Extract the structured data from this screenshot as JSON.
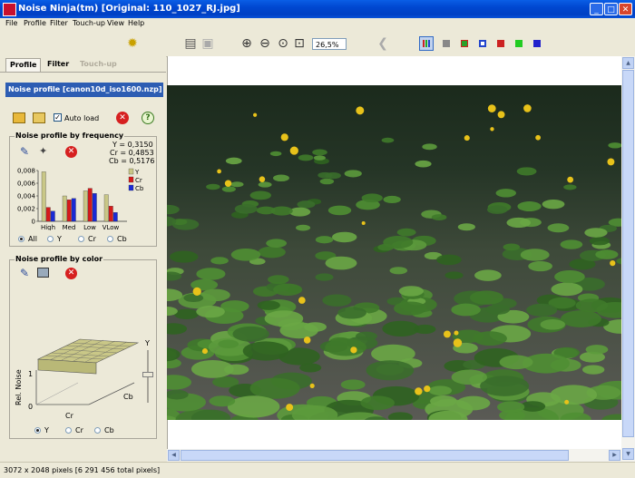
{
  "window": {
    "title": "Noise Ninja(tm)   [Original:  110_1027_RJ.jpg]"
  },
  "menu": [
    "File",
    "Profile",
    "Filter",
    "Touch-up",
    "View",
    "Help"
  ],
  "toolbar": {
    "zoom": "26,5%"
  },
  "colors": {
    "accent": "#2d5db3",
    "titlebar": "#0047d0",
    "swatches": [
      "#cc2222",
      "#888888",
      "#2aa02a",
      "#2244cc",
      "#cc2222",
      "#22cc22",
      "#2222cc"
    ]
  },
  "tabs": [
    "Profile",
    "Filter",
    "Touch-up"
  ],
  "profile": {
    "name": "Noise profile [canon10d_iso1600.nzp]",
    "autoload_label": "Auto load",
    "autoload_checked": true
  },
  "frequency": {
    "title": "Noise profile by frequency",
    "readout": {
      "y": "Y = 0,3150",
      "cr": "Cr = 0,4853",
      "cb": "Cb = 0,5176"
    },
    "radios": [
      "All",
      "Y",
      "Cr",
      "Cb"
    ],
    "selected_radio": "All"
  },
  "chart_data": {
    "type": "bar",
    "categories": [
      "High",
      "Med",
      "Low",
      "VLow"
    ],
    "series": [
      {
        "name": "Y",
        "values": [
          0.0078,
          0.004,
          0.0048,
          0.0042
        ]
      },
      {
        "name": "Cr",
        "values": [
          0.0022,
          0.0034,
          0.0052,
          0.0024
        ]
      },
      {
        "name": "Cb",
        "values": [
          0.0016,
          0.0036,
          0.0044,
          0.0014
        ]
      }
    ],
    "yticks": [
      "0,008",
      "0,006",
      "0,004",
      "0,002",
      "0"
    ],
    "ylim": [
      0,
      0.008
    ],
    "legend": "right"
  },
  "color_profile": {
    "title": "Noise profile by color",
    "yaxis_label": "Rel. Noise",
    "yticks": [
      "1",
      "0"
    ],
    "axis_cr": "Cr",
    "axis_cb": "Cb",
    "slider_label": "Y",
    "radios": [
      "Y",
      "Cr",
      "Cb"
    ],
    "selected_radio": "Y"
  },
  "status": {
    "text": "3072 x 2048 pixels [6 291 456 total pixels]"
  }
}
